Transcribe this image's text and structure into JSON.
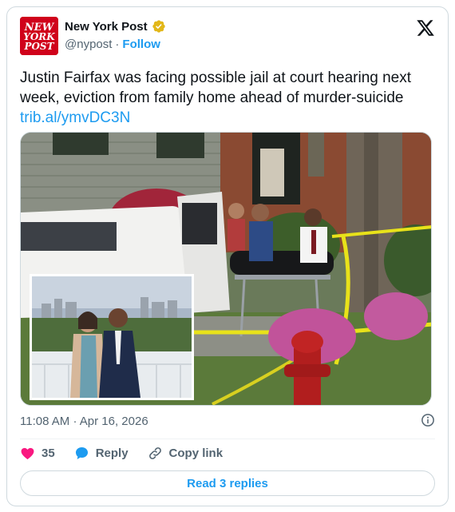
{
  "author": {
    "display_name": "New York Post",
    "handle": "@nypost",
    "separator": "·",
    "follow_label": "Follow",
    "avatar_text": [
      "NEW",
      "YORK",
      "POST"
    ],
    "verified": true,
    "verified_color": "#e2b719",
    "brand_color": "#d0021b"
  },
  "tweet": {
    "text": "Justin Fairfax was facing possible jail at court hearing next week, eviction from family home ahead of murder-suicide",
    "link": "trib.al/ymvDC3N"
  },
  "meta": {
    "time": "11:08 AM",
    "separator": "·",
    "date": "Apr 16, 2026"
  },
  "actions": {
    "like_count": "35",
    "reply_label": "Reply",
    "copy_link_label": "Copy link",
    "like_color": "#f91880",
    "reply_color": "#1d9bf0"
  },
  "read_replies_label": "Read 3 replies",
  "icons": {
    "platform": "x-logo-icon",
    "info": "info-icon",
    "like": "heart-icon",
    "reply": "speech-bubble-icon",
    "copy": "link-icon"
  },
  "colors": {
    "link": "#1d9bf0",
    "secondary_text": "#536471",
    "border": "#cfd9de"
  }
}
